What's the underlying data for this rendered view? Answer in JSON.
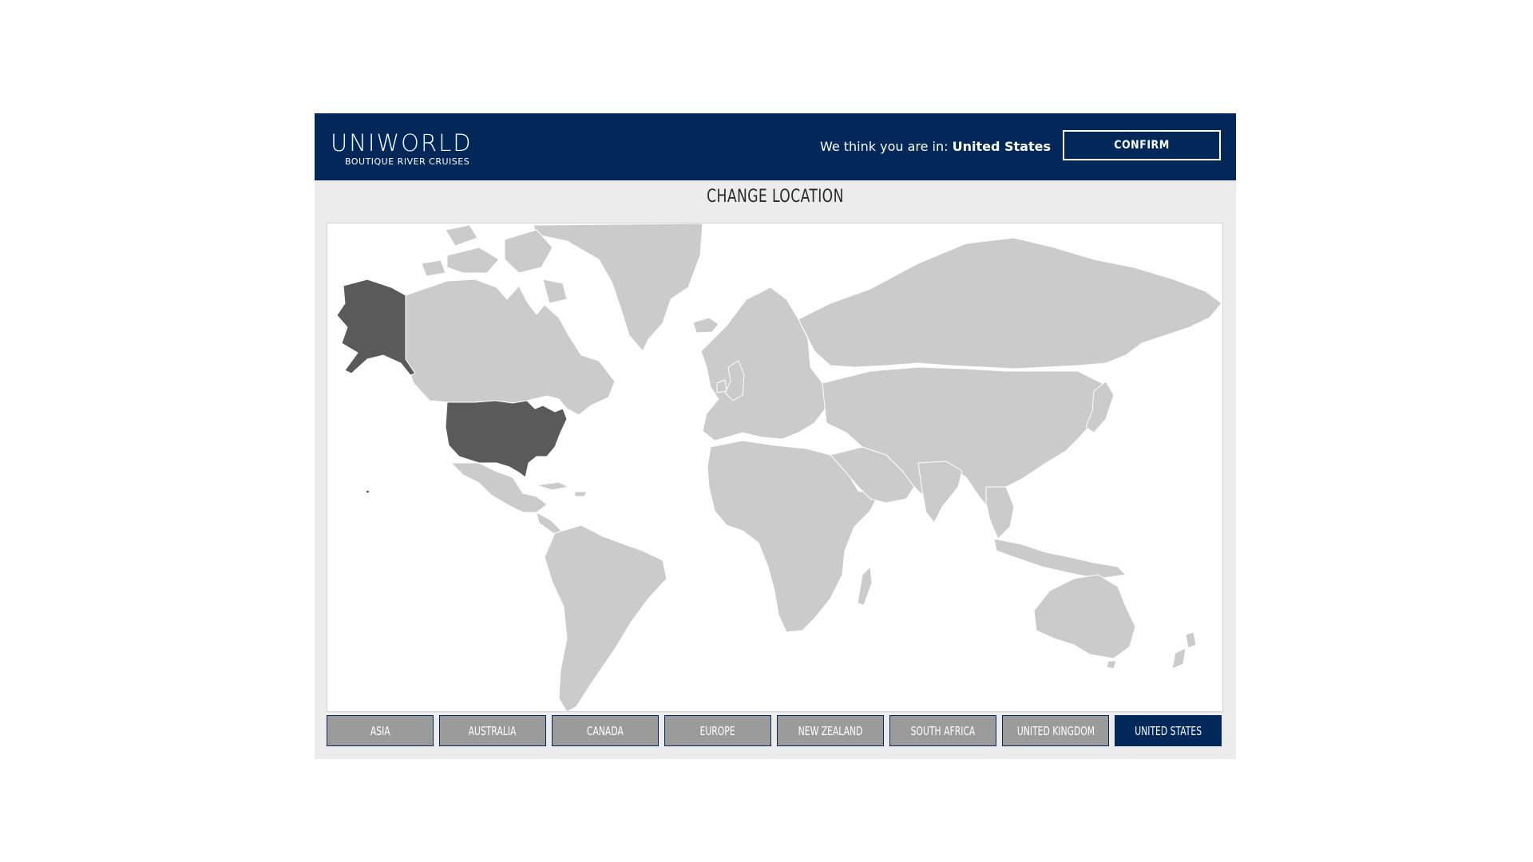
{
  "header": {
    "logo_word": "UNIWORLD",
    "logo_tagline": "BOUTIQUE RIVER CRUISES",
    "location_prefix": "We think you are in: ",
    "location_current": "United States",
    "confirm_label": "CONFIRM"
  },
  "title": "CHANGE LOCATION",
  "map": {
    "highlighted_country": "United States",
    "colors": {
      "land": "#cbcbcb",
      "highlight": "#5a5a5a",
      "background": "#ffffff"
    }
  },
  "countries": [
    {
      "label": "ASIA",
      "active": false
    },
    {
      "label": "AUSTRALIA",
      "active": false
    },
    {
      "label": "CANADA",
      "active": false
    },
    {
      "label": "EUROPE",
      "active": false
    },
    {
      "label": "NEW ZEALAND",
      "active": false
    },
    {
      "label": "SOUTH AFRICA",
      "active": false
    },
    {
      "label": "UNITED KINGDOM",
      "active": false
    },
    {
      "label": "UNITED STATES",
      "active": true
    }
  ],
  "colors": {
    "brand_navy": "#02285a",
    "button_gray": "#9b9b9b",
    "panel_gray": "#ececec"
  }
}
